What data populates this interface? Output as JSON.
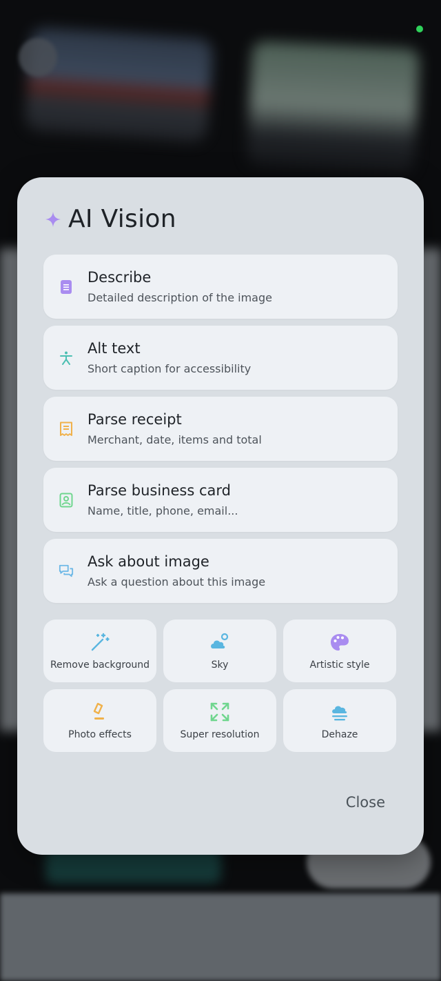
{
  "sheet": {
    "title": "AI Vision",
    "title_icon": "sparkle-icon",
    "accent": "#a98cf0",
    "actions": [
      {
        "icon": "document-icon",
        "title": "Describe",
        "subtitle": "Detailed description of the image",
        "color": "#a98cf0"
      },
      {
        "icon": "accessibility-icon",
        "title": "Alt text",
        "subtitle": "Short caption for accessibility",
        "color": "#4bbfb2"
      },
      {
        "icon": "receipt-icon",
        "title": "Parse receipt",
        "subtitle": "Merchant, date, items and total",
        "color": "#f0b14a"
      },
      {
        "icon": "contact-card-icon",
        "title": "Parse business card",
        "subtitle": "Name, title, phone, email...",
        "color": "#6fd68e"
      },
      {
        "icon": "chat-bubbles-icon",
        "title": "Ask about image",
        "subtitle": "Ask a question about this image",
        "color": "#6db8e6"
      }
    ],
    "tools": [
      {
        "icon": "magic-wand-icon",
        "label": "Remove background",
        "color": "#5ab6e0"
      },
      {
        "icon": "cloud-sun-icon",
        "label": "Sky",
        "color": "#5ab6e0"
      },
      {
        "icon": "palette-icon",
        "label": "Artistic style",
        "color": "#a98cf0"
      },
      {
        "icon": "eraser-icon",
        "label": "Photo effects",
        "color": "#f0b14a"
      },
      {
        "icon": "expand-icon",
        "label": "Super resolution",
        "color": "#6fd68e"
      },
      {
        "icon": "haze-icon",
        "label": "Dehaze",
        "color": "#5ab6e0"
      }
    ],
    "close_label": "Close"
  }
}
